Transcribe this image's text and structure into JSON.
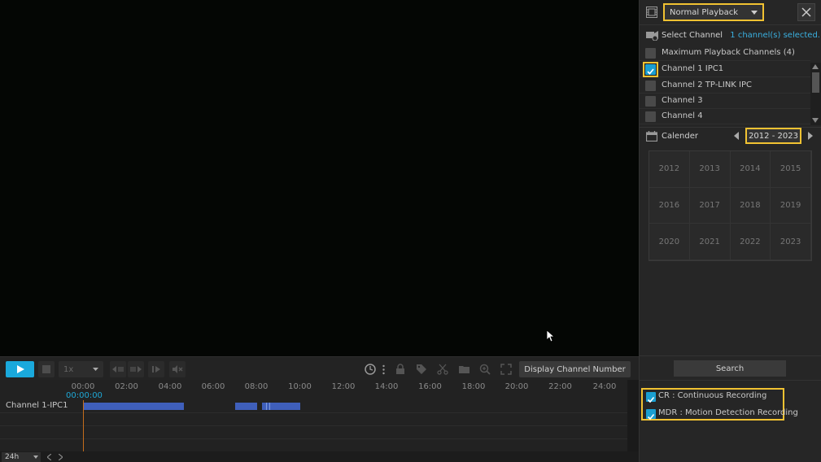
{
  "toolbar": {
    "speed": "1x",
    "display_channel_label": "Display Channel Number"
  },
  "timeline": {
    "ticks": [
      "00:00",
      "02:00",
      "04:00",
      "06:00",
      "08:00",
      "10:00",
      "12:00",
      "14:00",
      "16:00",
      "18:00",
      "20:00",
      "22:00",
      "24:00"
    ],
    "current_time": "00:00:00",
    "channel_label": "Channel 1-IPC1",
    "zoom": "24h",
    "record_color": "#3f5fbb",
    "playhead_color": "#c46d1c"
  },
  "panel": {
    "mode": "Normal Playback",
    "select_channel_title": "Select Channel",
    "selected_count": "1 channel(s) selected.",
    "channels": [
      {
        "label": "Maximum Playback Channels (4)",
        "checked": false
      },
      {
        "label": "Channel 1 IPC1",
        "checked": true
      },
      {
        "label": "Channel 2 TP-LINK IPC",
        "checked": false
      },
      {
        "label": "Channel 3",
        "checked": false
      },
      {
        "label": "Channel 4",
        "checked": false
      }
    ],
    "calendar_title": "Calender",
    "year_range": "2012 - 2023",
    "years": [
      "2012",
      "2013",
      "2014",
      "2015",
      "2016",
      "2017",
      "2018",
      "2019",
      "2020",
      "2021",
      "2022",
      "2023"
    ],
    "search_label": "Search",
    "legend": [
      {
        "label": "CR : Continuous Recording",
        "checked": true
      },
      {
        "label": "MDR : Motion Detection Recording",
        "checked": true
      }
    ]
  },
  "colors": {
    "accent": "#1aa9dc",
    "highlight": "#f1c232"
  }
}
